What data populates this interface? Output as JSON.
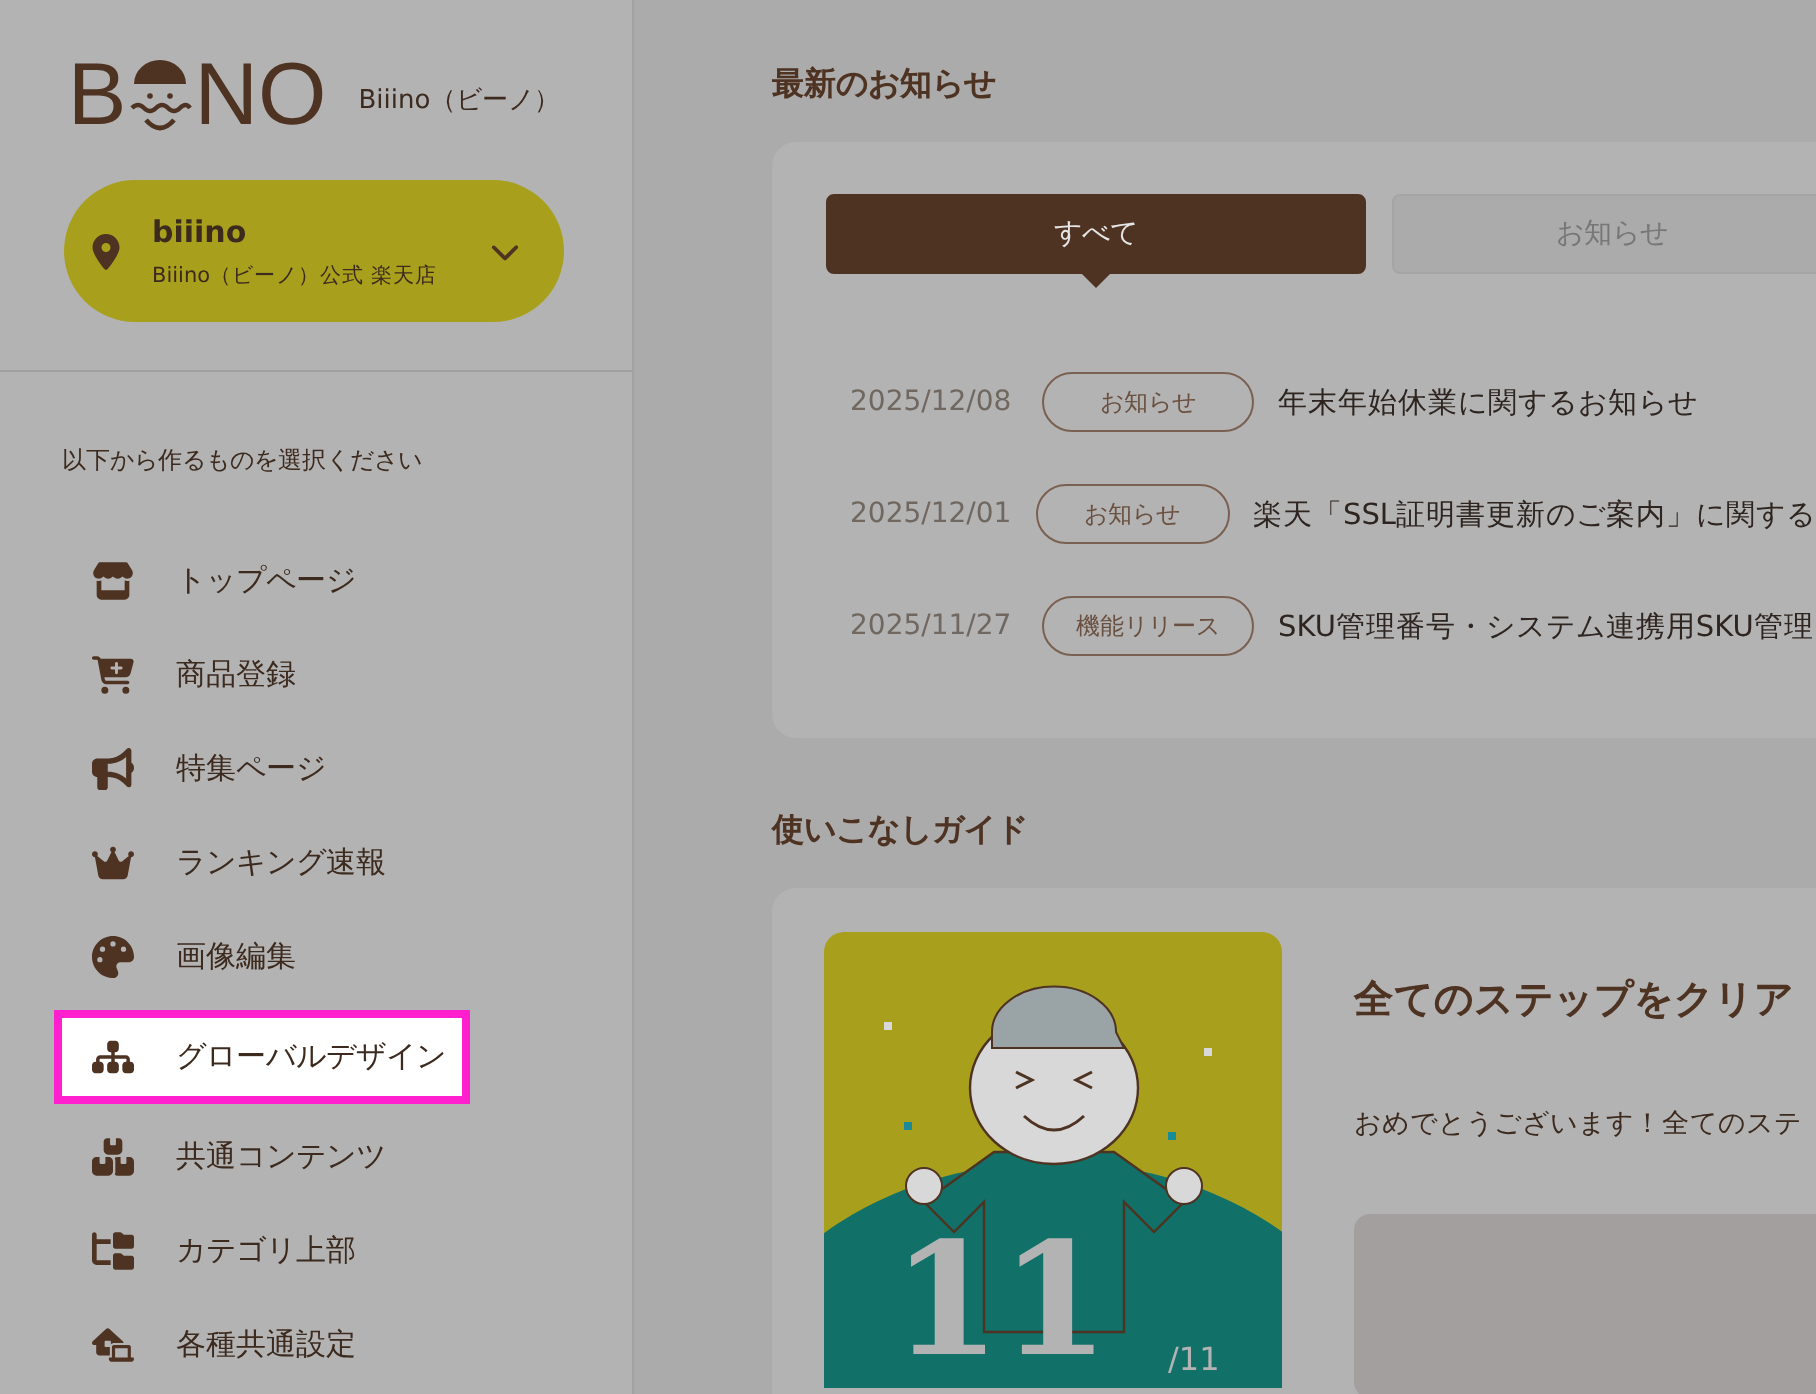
{
  "logo": {
    "left": "B",
    "right": "NO",
    "caption": "Biiino（ビーノ）"
  },
  "store": {
    "name": "biiino",
    "subtitle": "Biiino（ビーノ）公式 楽天店"
  },
  "sidebar": {
    "prompt": "以下から作るものを選択ください",
    "items": [
      {
        "label": "トップページ",
        "highlighted": false
      },
      {
        "label": "商品登録",
        "highlighted": false
      },
      {
        "label": "特集ページ",
        "highlighted": false
      },
      {
        "label": "ランキング速報",
        "highlighted": false
      },
      {
        "label": "画像編集",
        "highlighted": false
      },
      {
        "label": "グローバルデザイン",
        "highlighted": true
      },
      {
        "label": "共通コンテンツ",
        "highlighted": false
      },
      {
        "label": "カテゴリ上部",
        "highlighted": false
      },
      {
        "label": "各種共通設定",
        "highlighted": false
      }
    ]
  },
  "news": {
    "title": "最新のお知らせ",
    "tabs": [
      {
        "label": "すべて",
        "selected": true
      },
      {
        "label": "お知らせ",
        "selected": false
      }
    ],
    "items": [
      {
        "date": "2025/12/08",
        "tag": "お知らせ",
        "title": "年末年始休業に関するお知らせ"
      },
      {
        "date": "2025/12/01",
        "tag": "お知らせ",
        "title": "楽天「SSL証明書更新のご案内」に関する"
      },
      {
        "date": "2025/11/27",
        "tag": "機能リリース",
        "title": "SKU管理番号・システム連携用SKU管理"
      }
    ]
  },
  "guide": {
    "title": "使いこなしガイド",
    "step": "11",
    "total": "/11",
    "heading": "全てのステップをクリア",
    "message": "おめでとうございます！全てのステ"
  }
}
